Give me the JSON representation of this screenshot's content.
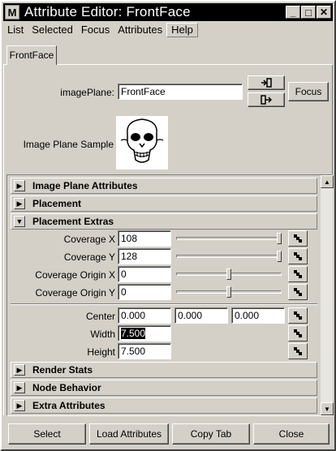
{
  "window": {
    "title": "Attribute Editor: FrontFace",
    "app_icon": "M",
    "minimize": "_",
    "maximize": "□",
    "close": "✕"
  },
  "menu": [
    "List",
    "Selected",
    "Focus",
    "Attributes",
    "Help"
  ],
  "tab": "FrontFace",
  "node": {
    "label": "imagePlane:",
    "value": "FrontFace",
    "focus_button": "Focus"
  },
  "sample": {
    "label": "Image Plane Sample",
    "icon": "skull-icon"
  },
  "sections": {
    "image_plane_attributes": "Image Plane Attributes",
    "placement": "Placement",
    "placement_extras": "Placement Extras",
    "render_stats": "Render Stats",
    "node_behavior": "Node Behavior",
    "extra_attributes": "Extra Attributes"
  },
  "coverage": {
    "x_label": "Coverage X",
    "x_value": "108",
    "y_label": "Coverage Y",
    "y_value": "128",
    "origin_x_label": "Coverage Origin X",
    "origin_x_value": "0",
    "origin_y_label": "Coverage Origin Y",
    "origin_y_value": "0"
  },
  "center": {
    "label": "Center",
    "x": "0.000",
    "y": "0.000",
    "z": "0.000"
  },
  "size": {
    "width_label": "Width",
    "width_value": "7.500",
    "height_label": "Height",
    "height_value": "7.500"
  },
  "footer": {
    "select": "Select",
    "load_attributes": "Load Attributes",
    "copy_tab": "Copy Tab",
    "close": "Close"
  }
}
